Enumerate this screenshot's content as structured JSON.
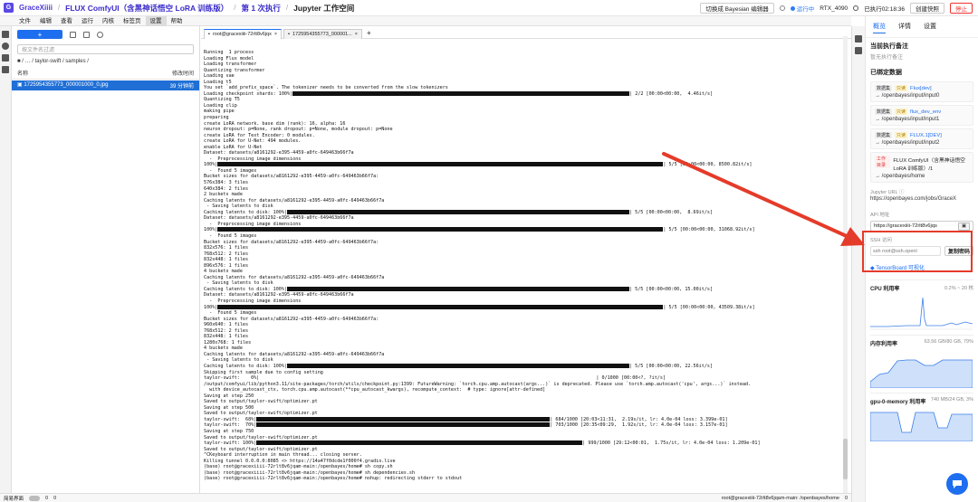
{
  "topbar": {
    "logo_text": "G",
    "brand": "GraceXiiii",
    "project": "FLUX ComfyUI（含黑神话悟空 LoRA 训练版）",
    "run": "第 1 次执行",
    "workspace": "Jupyter 工作空间",
    "bayes_btn": "切换成 Bayesian 编辑器",
    "status": "运行中",
    "gpu": "RTX_4090",
    "elapsed": "已执行02:18:36",
    "snapshot_btn": "创建快照",
    "stop_btn": "停止"
  },
  "menu": [
    "文件",
    "编辑",
    "查看",
    "运行",
    "内核",
    "标签页",
    "设置",
    "帮助"
  ],
  "filepanel": {
    "new_label": "+",
    "search_placeholder": "按文件名过滤",
    "path": "/ … / taylor-swift / samples /",
    "col_name": "名称",
    "col_modified": "修改时间",
    "file_name": "1725954355773_000001000_0.jpg",
    "file_time": "39 分钟前"
  },
  "tabs": [
    {
      "label": "root@gracexiiii-72rlt8v6jqx"
    },
    {
      "label": "1725954355773_000001..."
    }
  ],
  "terminal": {
    "lines": [
      {
        "t": "Running  1 process"
      },
      {
        "t": "Loading Flux model"
      },
      {
        "t": "Loading transformer"
      },
      {
        "t": "Quantizing transformer"
      },
      {
        "t": "Loading vae"
      },
      {
        "t": "Loading t5"
      },
      {
        "t": "You set `add_prefix_space`. The tokenizer needs to be converted from the slow tokenizers"
      },
      {
        "t": "Loading checkpoint shards: 100%|",
        "bar": 0.62,
        "after": "| 2/2 [00:00<00:00,  4.46it/s]"
      },
      {
        "t": "Quantizing T5"
      },
      {
        "t": "Loading clip"
      },
      {
        "t": "making pipe"
      },
      {
        "t": "preparing"
      },
      {
        "t": "create LoRA network. base dim (rank): 16, alpha: 16"
      },
      {
        "t": "neuron dropout: p=None, rank dropout: p=None, module dropout: p=None"
      },
      {
        "t": "create LoRA for Text Encoder: 0 modules."
      },
      {
        "t": "create LoRA for U-Net: 494 modules."
      },
      {
        "t": "enable LoRA for U-Net"
      },
      {
        "t": "Dataset: datasets/a8161292-e395-4459-a0fc-649463b66f7a"
      },
      {
        "t": "  -  Preprocessing image dimensions"
      },
      {
        "t": "100%|",
        "bar": 0.82,
        "after": "| 5/5 [00:00<00:00, 8500.82it/s]"
      },
      {
        "t": "  -  Found 5 images"
      },
      {
        "t": "Bucket sizes for datasets/a8161292-e395-4459-a0fc-649463b66f7a:"
      },
      {
        "t": "576x384: 3 files"
      },
      {
        "t": "640x384: 2 files"
      },
      {
        "t": "2 buckets made"
      },
      {
        "t": "Caching latents for datasets/a8161292-e395-4459-a0fc-649463b66f7a"
      },
      {
        "t": " - Saving latents to disk"
      },
      {
        "t": "Caching latents to disk: 100%|",
        "bar": 0.63,
        "after": "| 5/5 [00:00<00:00,  8.69it/s]"
      },
      {
        "t": "Dataset: datasets/a8161292-e395-4459-a0fc-649463b66f7a"
      },
      {
        "t": "  -  Preprocessing image dimensions"
      },
      {
        "t": "100%|",
        "bar": 0.82,
        "after": "| 5/5 [00:00<00:00, 31068.92it/s]"
      },
      {
        "t": "  -  Found 5 images"
      },
      {
        "t": "Bucket sizes for datasets/a8161292-e395-4459-a0fc-649463b66f7a:"
      },
      {
        "t": "832x576: 1 files"
      },
      {
        "t": "768x512: 2 files"
      },
      {
        "t": "832x448: 1 files"
      },
      {
        "t": "896x576: 1 files"
      },
      {
        "t": "4 buckets made"
      },
      {
        "t": "Caching latents for datasets/a8161292-e395-4459-a0fc-649463b66f7a"
      },
      {
        "t": " - Saving latents to disk"
      },
      {
        "t": "Caching latents to disk: 100%|",
        "bar": 0.63,
        "after": "| 5/5 [00:00<00:00, 15.00it/s]"
      },
      {
        "t": "Dataset: datasets/a8161292-e395-4459-a0fc-649463b66f7a"
      },
      {
        "t": "  -  Preprocessing image dimensions"
      },
      {
        "t": "100%|",
        "bar": 0.82,
        "after": "| 5/5 [00:00<00:00, 43509.38it/s]"
      },
      {
        "t": "  -  Found 5 images"
      },
      {
        "t": "Bucket sizes for datasets/a8161292-e395-4459-a0fc-649463b66f7a:"
      },
      {
        "t": "960x640: 1 files"
      },
      {
        "t": "768x512: 2 files"
      },
      {
        "t": "832x448: 1 files"
      },
      {
        "t": "1280x768: 1 files"
      },
      {
        "t": "4 buckets made"
      },
      {
        "t": "Caching latents for datasets/a8161292-e395-4459-a0fc-649463b66f7a"
      },
      {
        "t": " - Saving latents to disk"
      },
      {
        "t": "Caching latents to disk: 100%|",
        "bar": 0.63,
        "after": "| 5/5 [00:00<00:00, 22.56it/s]"
      },
      {
        "t": "Skipping first sample due to config setting"
      },
      {
        "t": "taylor-swift:    0%|",
        "gap": 0.62,
        "after": "| 0/1000 [00:00<?, ?it/s]"
      },
      {
        "t": "/output/comfyui/lib/python3.11/site-packages/torch/utils/checkpoint.py:1399: FutureWarning: `torch.cpu.amp.autocast(args...)` is deprecated. Please use `torch.amp.autocast('cpu', args...)` instead."
      },
      {
        "t": "  with device_autocast_ctx, torch.cpu.amp.autocast(**cpu_autocast_kwargs), recompute_context:  # type: ignore[attr-defined]"
      },
      {
        "t": "Saving at step 250"
      },
      {
        "t": "Saved to output/taylor-swift/optimizer.pt"
      },
      {
        "t": "Saving at step 500"
      },
      {
        "t": "Saved to output/taylor-swift/optimizer.pt"
      },
      {
        "t": "taylor-swift:  68%|",
        "bar": 0.54,
        "after": "| 684/1000 [20:03<11:31,  2.19s/it, lr: 4.0e-04 loss: 3.399e-01]"
      },
      {
        "t": "taylor-swift:  70%|",
        "bar": 0.54,
        "after": "| 703/1000 [20:35<09:29,  1.92s/it, lr: 4.0e-04 loss: 3.157e-01]"
      },
      {
        "t": "Saving at step 750"
      },
      {
        "t": "Saved to output/taylor-swift/optimizer.pt"
      },
      {
        "t": "taylor-swift: 100%|",
        "bar": 0.6,
        "after": "| 999/1000 [29:12<00:01,  1.75s/it, lr: 4.0e-04 loss: 1.209e-01]"
      },
      {
        "t": ""
      },
      {
        "t": "Saved to output/taylor-swift/optimizer.pt"
      },
      {
        "t": "^CKeyboard interruption in main thread... closing server."
      },
      {
        "t": "Killing tunnel 0.0.0.0:8085 <> https://14a47f0dcde1f000f4.gradio.live"
      },
      {
        "t": ""
      },
      {
        "t": "(base) root@gracexiiii-72rlt8v6jqam-main:/openbayes/home# sh copy.sh"
      },
      {
        "t": "(base) root@gracexiiii-72rlt8v6jqam-main:/openbayes/home# sh dependencies.sh"
      },
      {
        "t": "(base) root@gracexiiii-72rlt8v6jqam-main:/openbayes/home# nohup: redirecting stderr to stdout"
      }
    ]
  },
  "statusbar": {
    "mode": "简易界面",
    "n1": "0",
    "n2": "0",
    "right": "root@gracexiiii-72rlt8v6jqam-main: /openbayes/home",
    "num": "0"
  },
  "rightpanel": {
    "tabs": [
      "概览",
      "详情",
      "设置"
    ],
    "note_title": "当前执行备注",
    "note_sub": "暂无执行备注",
    "bound_title": "已绑定数据",
    "datasets": [
      {
        "type": "数据集",
        "tag": "只读",
        "name": "Flux[dev]",
        "path": "→ /openbayes/input/input0"
      },
      {
        "type": "数据集",
        "tag": "只读",
        "name": "flux_dev_env",
        "path": "→ /openbayes/input/input1"
      },
      {
        "type": "数据集",
        "tag": "只读",
        "name": "FLUX.1[DEV]",
        "path": "→ /openbayes/input/input2"
      },
      {
        "type": "工作目录",
        "tag": "",
        "name": "FLUX ComfyUI（含黑神话悟空 LoRA 训练版）/1",
        "path": "→ /openbayes/home"
      }
    ],
    "jupyter_label": "Jupyter URL",
    "jupyter_url": "https://openbayes.com/jobs/GraceX",
    "api_label": "API 地址",
    "api_url": "https://gracexiiii-72rlt8v6jqs",
    "ssh_label": "SSH 访问",
    "ssh_cmd": "ssh root@ssh.openl",
    "ssh_btn": "复制密码",
    "tensorboard": "TensorBoard 可视化",
    "metrics": [
      {
        "name": "CPU 利用率",
        "value": "0.2% ~ 20 核"
      },
      {
        "name": "内存利用率",
        "value": "63.56 GB/80 GB, 79%"
      },
      {
        "name": "gpu-0-memory 利用率",
        "value": "740 MB/24 GB, 3%"
      }
    ]
  },
  "colors": {
    "accent": "#1e6ef0",
    "brand": "#4a3ad6",
    "highlight": "#e53b2a",
    "stop": "#e33333"
  }
}
